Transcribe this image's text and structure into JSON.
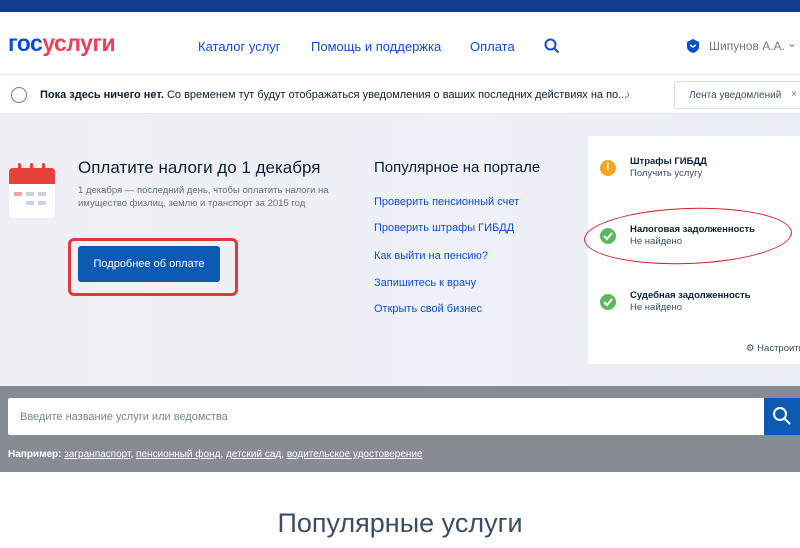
{
  "header": {
    "logo_part1": "гос",
    "logo_part2": "услуги",
    "nav": [
      "Каталог услуг",
      "Помощь и поддержка",
      "Оплата"
    ],
    "user_name": "Шипунов А.А.",
    "user_chevron": "⌄",
    "search_icon": "search-icon",
    "brand_color": "#0d4cd3",
    "accent_color": "#ee3f58"
  },
  "notifications": {
    "bold_text": "Пока здесь ничего нет.",
    "text": "Со временем тут будут отображаться уведомления о ваших последних действиях на по...",
    "chevron": "›",
    "feed_button": "Лента уведомлений",
    "close": "×"
  },
  "hero": {
    "title": "Оплатите налоги до 1 декабря",
    "description": "1 декабря — последний день, чтобы оплатить налоги на имущество физлиц, землю и транспорт за 2015 год",
    "pay_button": "Подробнее об оплате",
    "popular_title": "Популярное на портале",
    "popular_links": [
      "Проверить пенсионный счет",
      "Проверить штрафы ГИБДД",
      "Как выйти на пенсию?",
      "Запишитесь к врачу",
      "Открыть свой бизнес"
    ]
  },
  "status_panel": {
    "items": [
      {
        "title": "Штрафы ГИБДД",
        "subtitle": "Получить услугу",
        "status": "warning",
        "color": "#f5a623"
      },
      {
        "title": "Налоговая задолженность",
        "subtitle": "Не найдено",
        "status": "ok",
        "color": "#5cb85c"
      },
      {
        "title": "Судебная задолженность",
        "subtitle": "Не найдено",
        "status": "ok",
        "color": "#5cb85c"
      }
    ],
    "settings": "Настроить"
  },
  "search": {
    "placeholder": "Введите название услуги или ведомства",
    "example_label": "Например:",
    "examples": [
      "загранпаспорт",
      "пенсионный фонд",
      "детский сад",
      "водительское удостоверение"
    ]
  },
  "popular_services_title": "Популярные услуги"
}
